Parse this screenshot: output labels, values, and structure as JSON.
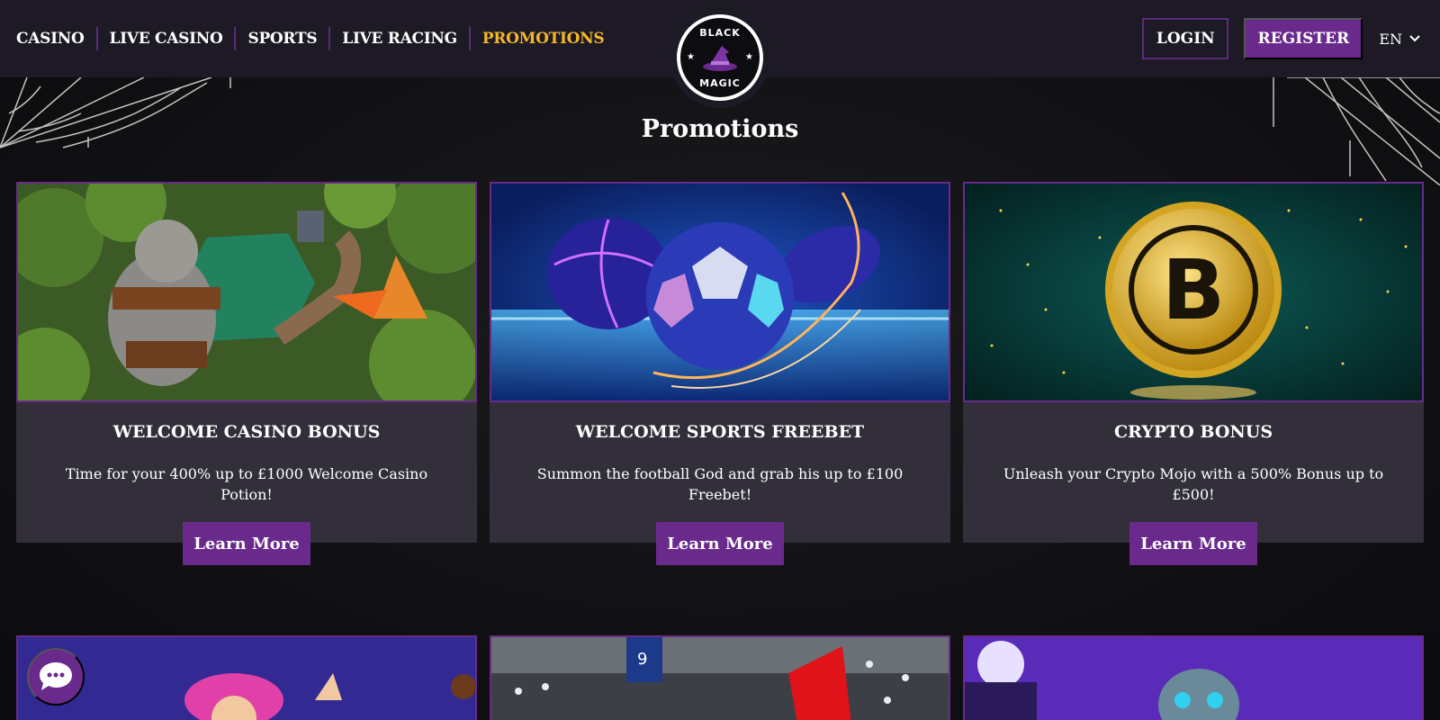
{
  "nav": {
    "items": [
      {
        "label": "CASINO"
      },
      {
        "label": "LIVE CASINO"
      },
      {
        "label": "SPORTS"
      },
      {
        "label": "LIVE RACING"
      },
      {
        "label": "PROMOTIONS",
        "active": true
      }
    ]
  },
  "logo": {
    "top": "BLACK",
    "bottom": "MAGIC"
  },
  "header": {
    "login_label": "LOGIN",
    "register_label": "REGISTER",
    "language": "EN"
  },
  "page": {
    "title": "Promotions"
  },
  "promos": [
    {
      "title": "WELCOME CASINO BONUS",
      "description": "Time for your 400% up to £1000 Welcome Casino Potion!",
      "button": "Learn More"
    },
    {
      "title": "WELCOME SPORTS FREEBET",
      "description": "Summon the football God and grab his up to £100 Freebet!",
      "button": "Learn More"
    },
    {
      "title": "CRYPTO BONUS",
      "description": "Unleash your Crypto Mojo with a 500% Bonus up to £500!",
      "button": "Learn More"
    }
  ],
  "colors": {
    "accent": "#6a2a8c",
    "active_nav": "#f5b72a",
    "header_bg": "#1d1a25",
    "card_bg": "#322f3a"
  },
  "icons": {
    "chat": "chat-bubble-icon",
    "language_caret": "chevron-down-icon"
  }
}
